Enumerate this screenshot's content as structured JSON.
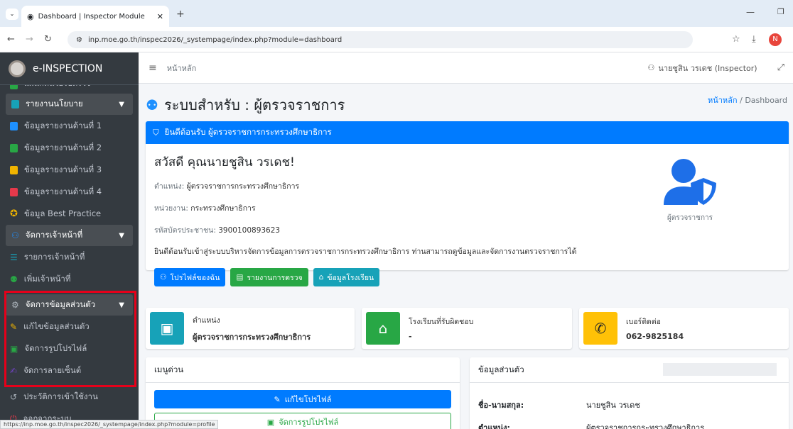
{
  "browser": {
    "tab_title": "Dashboard | Inspector Module",
    "url": "inp.moe.go.th/inspec2026/_systempage/index.php?module=dashboard",
    "status_url": "https://inp.moe.go.th/inspec2026/_systempage/index.php?module=profile",
    "profile_initial": "N"
  },
  "sidebar": {
    "brand": "e-INSPECTION",
    "partial_top": "แผนกหน่วยรับตรวจ",
    "items": [
      {
        "label": "รายงานนโยบาย",
        "kind": "header"
      },
      {
        "label": "ข้อมูลรายงานด้านที่ 1",
        "color": "#1e90ff"
      },
      {
        "label": "ข้อมูลรายงานด้านที่ 2",
        "color": "#28a745"
      },
      {
        "label": "ข้อมูลรายงานด้านที่ 3",
        "color": "#f0b400"
      },
      {
        "label": "ข้อมูลรายงานด้านที่ 4",
        "color": "#e6394b"
      },
      {
        "label": "ข้อมูล Best Practice",
        "color": "#f0b400"
      },
      {
        "label": "จัดการเจ้าหน้าที่",
        "kind": "section"
      },
      {
        "label": "รายการเจ้าหน้าที่",
        "color": "#17a2b8"
      },
      {
        "label": "เพิ่มเจ้าหน้าที่",
        "color": "#28a745"
      },
      {
        "label": "จัดการข้อมูลส่วนตัว",
        "kind": "section"
      },
      {
        "label": "แก้ไขข้อมูลส่วนตัว",
        "color": "#f0b400"
      },
      {
        "label": "จัดการรูปโปรไฟล์",
        "color": "#28a745"
      },
      {
        "label": "จัดการลายเซ็นต์",
        "color": "#6f42c1"
      },
      {
        "label": "ประวัติการเข้าใช้งาน",
        "color": "#adb5bd"
      },
      {
        "label": "ออกจากระบบ",
        "color": "#e6394b"
      }
    ]
  },
  "header": {
    "home": "หน้าหลัก",
    "user": "นายชูสิน วรเดช (Inspector)"
  },
  "page": {
    "title": "ระบบสำหรับ : ผู้ตรวจราชการ",
    "breadcrumb_home": "หน้าหลัก",
    "breadcrumb_sep": "/",
    "breadcrumb_current": "Dashboard"
  },
  "welcome": {
    "banner": "ยินดีต้อนรับ ผู้ตรวจราชการกระทรวงศึกษาธิการ",
    "greeting": "สวัสดี คุณนายชูสิน วรเดช!",
    "position_label": "ตำแหน่ง:",
    "position": "ผู้ตรวจราชการกระทรวงศึกษาธิการ",
    "agency_label": "หน่วยงาน:",
    "agency": "กระทรวงศึกษาธิการ",
    "id_label": "รหัสบัตรประชาชน:",
    "id": "3900100893623",
    "paragraph": "ยินดีต้อนรับเข้าสู่ระบบบริหารจัดการข้อมูลการตรวจราชการกระทรวงศึกษาธิการ ท่านสามารถดูข้อมูลและจัดการงานตรวจราชการได้",
    "role": "ผู้ตรวจราชการ",
    "buttons": [
      "โปรไฟล์ของฉัน",
      "รายงานการตรวจ",
      "ข้อมูลโรงเรียน"
    ]
  },
  "info_boxes": [
    {
      "title": "ตำแหน่ง",
      "value": "ผู้ตรวจราชการกระทรวงศึกษาธิการ",
      "color": "#17a2b8"
    },
    {
      "title": "โรงเรียนที่รับผิดชอบ",
      "value": "-",
      "color": "#28a745"
    },
    {
      "title": "เบอร์ติดต่อ",
      "value": "062-9825184",
      "color": "#ffc107"
    }
  ],
  "quick_menu": {
    "title": "เมนูด่วน",
    "buttons": [
      "แก้ไขโปรไฟล์",
      "จัดการรูปโปรไฟล์"
    ]
  },
  "personal": {
    "title": "ข้อมูลส่วนตัว",
    "name_label": "ชื่อ-นามสกุล:",
    "name": "นายชูสิน วรเดช",
    "position_label": "ตำแหน่ง:",
    "position": "ผู้ตรวจราชการกระทรวงศึกษาธิการ"
  }
}
